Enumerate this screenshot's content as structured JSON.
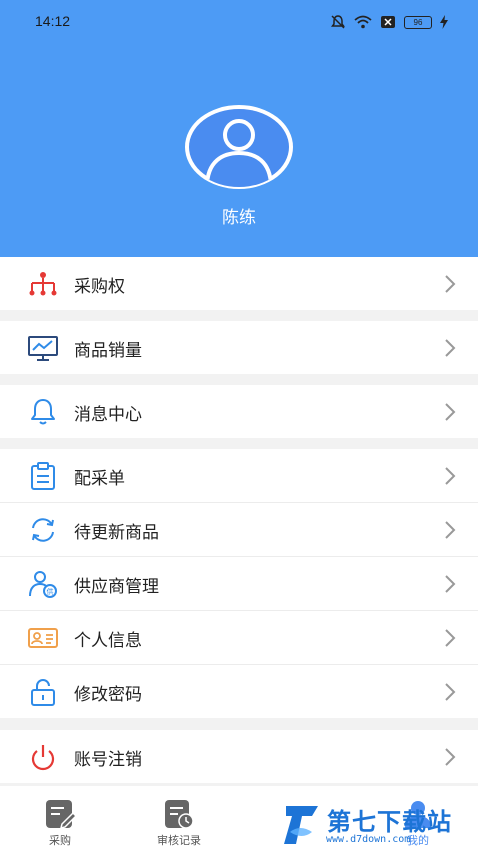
{
  "status_bar": {
    "time": "14:12",
    "battery": "96"
  },
  "profile": {
    "name": "陈练"
  },
  "menu": {
    "purchase_rights": "采购权",
    "product_sales": "商品销量",
    "message_center": "消息中心",
    "distribution_order": "配采单",
    "pending_update_products": "待更新商品",
    "supplier_management": "供应商管理",
    "personal_info": "个人信息",
    "change_password": "修改密码",
    "account_cancel": "账号注销"
  },
  "tabs": {
    "purchase": "采购",
    "audit_records": "审核记录",
    "mine": "我的"
  },
  "watermark": {
    "name": "第七下载站",
    "url": "www.d7down.com"
  },
  "colors": {
    "header_blue": "#4d9bf5",
    "icon_blue": "#2f8be8",
    "icon_red": "#e53935",
    "icon_orange": "#f0a04b"
  }
}
